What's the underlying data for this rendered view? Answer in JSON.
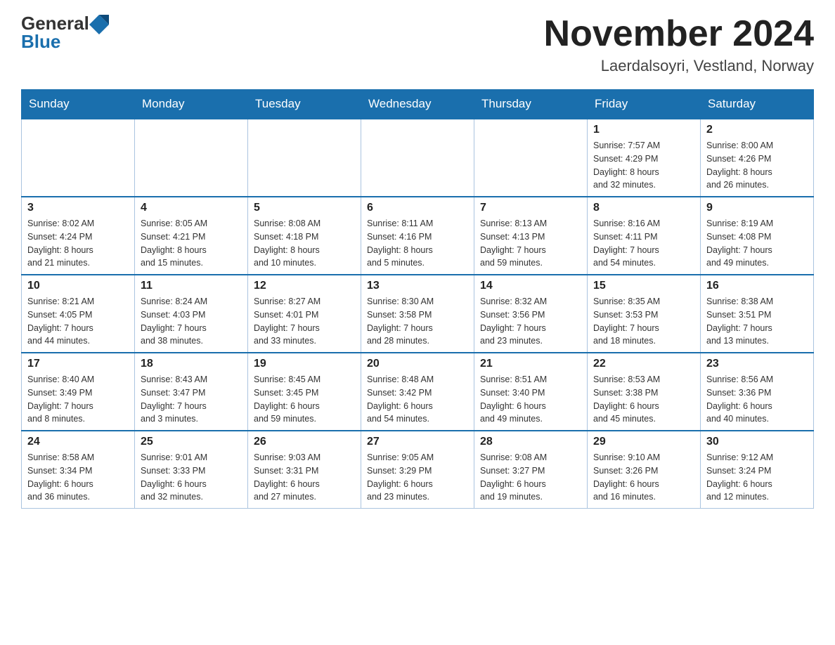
{
  "header": {
    "logo_general": "General",
    "logo_blue": "Blue",
    "month_title": "November 2024",
    "location": "Laerdalsoyri, Vestland, Norway"
  },
  "days_of_week": [
    "Sunday",
    "Monday",
    "Tuesday",
    "Wednesday",
    "Thursday",
    "Friday",
    "Saturday"
  ],
  "weeks": [
    [
      {
        "day": "",
        "info": ""
      },
      {
        "day": "",
        "info": ""
      },
      {
        "day": "",
        "info": ""
      },
      {
        "day": "",
        "info": ""
      },
      {
        "day": "",
        "info": ""
      },
      {
        "day": "1",
        "info": "Sunrise: 7:57 AM\nSunset: 4:29 PM\nDaylight: 8 hours\nand 32 minutes."
      },
      {
        "day": "2",
        "info": "Sunrise: 8:00 AM\nSunset: 4:26 PM\nDaylight: 8 hours\nand 26 minutes."
      }
    ],
    [
      {
        "day": "3",
        "info": "Sunrise: 8:02 AM\nSunset: 4:24 PM\nDaylight: 8 hours\nand 21 minutes."
      },
      {
        "day": "4",
        "info": "Sunrise: 8:05 AM\nSunset: 4:21 PM\nDaylight: 8 hours\nand 15 minutes."
      },
      {
        "day": "5",
        "info": "Sunrise: 8:08 AM\nSunset: 4:18 PM\nDaylight: 8 hours\nand 10 minutes."
      },
      {
        "day": "6",
        "info": "Sunrise: 8:11 AM\nSunset: 4:16 PM\nDaylight: 8 hours\nand 5 minutes."
      },
      {
        "day": "7",
        "info": "Sunrise: 8:13 AM\nSunset: 4:13 PM\nDaylight: 7 hours\nand 59 minutes."
      },
      {
        "day": "8",
        "info": "Sunrise: 8:16 AM\nSunset: 4:11 PM\nDaylight: 7 hours\nand 54 minutes."
      },
      {
        "day": "9",
        "info": "Sunrise: 8:19 AM\nSunset: 4:08 PM\nDaylight: 7 hours\nand 49 minutes."
      }
    ],
    [
      {
        "day": "10",
        "info": "Sunrise: 8:21 AM\nSunset: 4:05 PM\nDaylight: 7 hours\nand 44 minutes."
      },
      {
        "day": "11",
        "info": "Sunrise: 8:24 AM\nSunset: 4:03 PM\nDaylight: 7 hours\nand 38 minutes."
      },
      {
        "day": "12",
        "info": "Sunrise: 8:27 AM\nSunset: 4:01 PM\nDaylight: 7 hours\nand 33 minutes."
      },
      {
        "day": "13",
        "info": "Sunrise: 8:30 AM\nSunset: 3:58 PM\nDaylight: 7 hours\nand 28 minutes."
      },
      {
        "day": "14",
        "info": "Sunrise: 8:32 AM\nSunset: 3:56 PM\nDaylight: 7 hours\nand 23 minutes."
      },
      {
        "day": "15",
        "info": "Sunrise: 8:35 AM\nSunset: 3:53 PM\nDaylight: 7 hours\nand 18 minutes."
      },
      {
        "day": "16",
        "info": "Sunrise: 8:38 AM\nSunset: 3:51 PM\nDaylight: 7 hours\nand 13 minutes."
      }
    ],
    [
      {
        "day": "17",
        "info": "Sunrise: 8:40 AM\nSunset: 3:49 PM\nDaylight: 7 hours\nand 8 minutes."
      },
      {
        "day": "18",
        "info": "Sunrise: 8:43 AM\nSunset: 3:47 PM\nDaylight: 7 hours\nand 3 minutes."
      },
      {
        "day": "19",
        "info": "Sunrise: 8:45 AM\nSunset: 3:45 PM\nDaylight: 6 hours\nand 59 minutes."
      },
      {
        "day": "20",
        "info": "Sunrise: 8:48 AM\nSunset: 3:42 PM\nDaylight: 6 hours\nand 54 minutes."
      },
      {
        "day": "21",
        "info": "Sunrise: 8:51 AM\nSunset: 3:40 PM\nDaylight: 6 hours\nand 49 minutes."
      },
      {
        "day": "22",
        "info": "Sunrise: 8:53 AM\nSunset: 3:38 PM\nDaylight: 6 hours\nand 45 minutes."
      },
      {
        "day": "23",
        "info": "Sunrise: 8:56 AM\nSunset: 3:36 PM\nDaylight: 6 hours\nand 40 minutes."
      }
    ],
    [
      {
        "day": "24",
        "info": "Sunrise: 8:58 AM\nSunset: 3:34 PM\nDaylight: 6 hours\nand 36 minutes."
      },
      {
        "day": "25",
        "info": "Sunrise: 9:01 AM\nSunset: 3:33 PM\nDaylight: 6 hours\nand 32 minutes."
      },
      {
        "day": "26",
        "info": "Sunrise: 9:03 AM\nSunset: 3:31 PM\nDaylight: 6 hours\nand 27 minutes."
      },
      {
        "day": "27",
        "info": "Sunrise: 9:05 AM\nSunset: 3:29 PM\nDaylight: 6 hours\nand 23 minutes."
      },
      {
        "day": "28",
        "info": "Sunrise: 9:08 AM\nSunset: 3:27 PM\nDaylight: 6 hours\nand 19 minutes."
      },
      {
        "day": "29",
        "info": "Sunrise: 9:10 AM\nSunset: 3:26 PM\nDaylight: 6 hours\nand 16 minutes."
      },
      {
        "day": "30",
        "info": "Sunrise: 9:12 AM\nSunset: 3:24 PM\nDaylight: 6 hours\nand 12 minutes."
      }
    ]
  ]
}
